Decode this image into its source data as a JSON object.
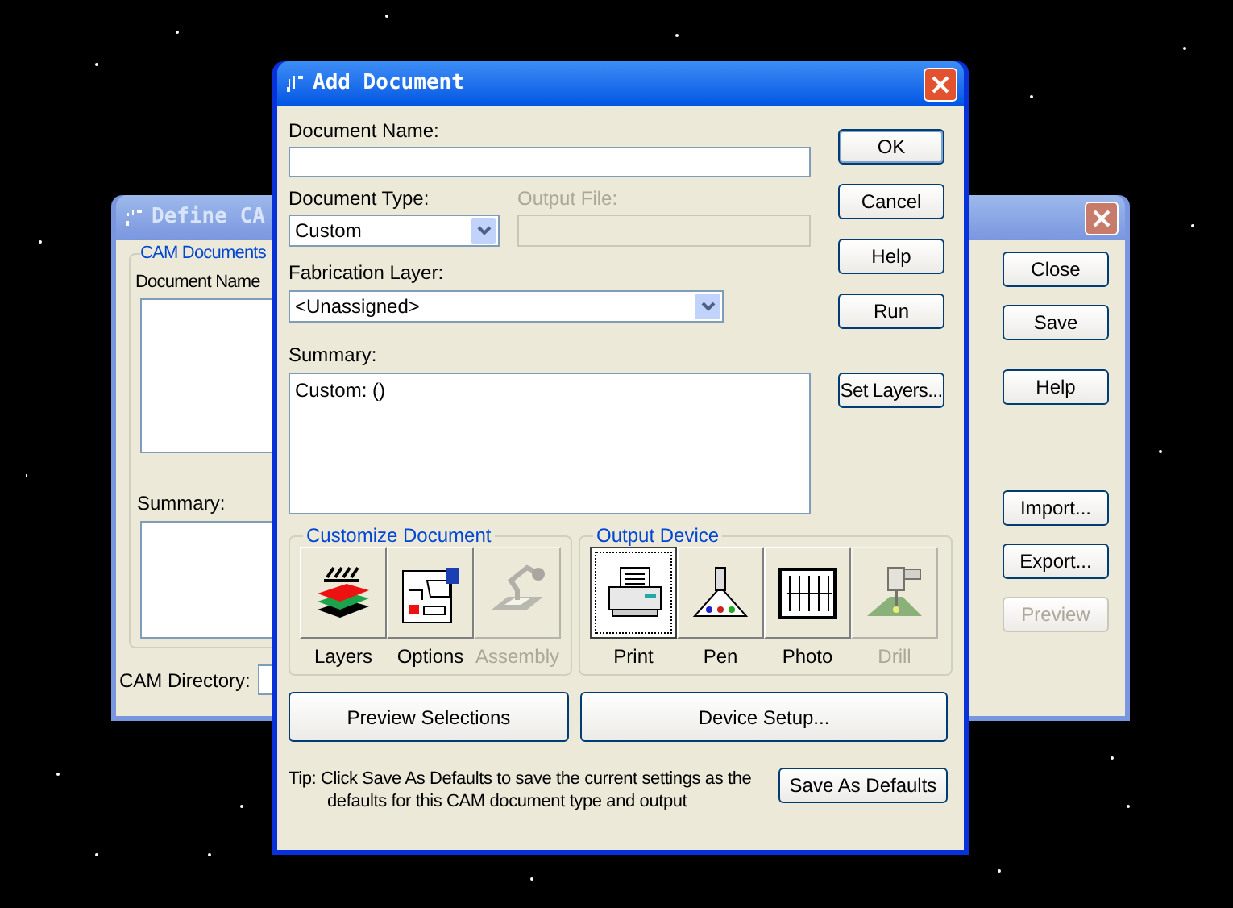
{
  "back_window": {
    "title": "Define CA",
    "group_label": "CAM Documents",
    "list_label": "Document Name",
    "summary_label": "Summary:",
    "directory_label": "CAM Directory:",
    "buttons": [
      {
        "label": "Close",
        "disabled": false
      },
      {
        "label": "Save",
        "disabled": false
      },
      {
        "label": "Help",
        "disabled": false
      },
      {
        "label": "Import...",
        "disabled": false
      },
      {
        "label": "Export...",
        "disabled": false
      },
      {
        "label": "Preview",
        "disabled": true
      }
    ]
  },
  "dialog": {
    "title": "Add Document",
    "name_label": "Document Name:",
    "type_label": "Document Type:",
    "type_value": "Custom",
    "output_label": "Output File:",
    "output_disabled": true,
    "layer_label": "Fabrication Layer:",
    "layer_value": "<Unassigned>",
    "summary_label": "Summary:",
    "summary_value": "Custom: ()",
    "buttons": [
      {
        "label": "OK",
        "default": true
      },
      {
        "label": "Cancel",
        "default": false
      },
      {
        "label": "Help",
        "default": false
      },
      {
        "label": "Run",
        "default": false
      },
      {
        "label": "Set Layers...",
        "default": false
      }
    ],
    "customize": {
      "label": "Customize Document",
      "items": [
        {
          "kind": "layers",
          "label": "Layers",
          "disabled": false
        },
        {
          "kind": "options",
          "label": "Options",
          "disabled": false
        },
        {
          "kind": "assembly",
          "label": "Assembly",
          "disabled": true
        }
      ]
    },
    "output_device": {
      "label": "Output Device",
      "items": [
        {
          "kind": "print",
          "label": "Print",
          "selected": true,
          "disabled": false
        },
        {
          "kind": "pen",
          "label": "Pen",
          "selected": false,
          "disabled": false
        },
        {
          "kind": "photo",
          "label": "Photo",
          "selected": false,
          "disabled": false
        },
        {
          "kind": "drill",
          "label": "Drill",
          "selected": false,
          "disabled": true
        }
      ]
    },
    "preview_button": "Preview Selections",
    "setup_button": "Device Setup...",
    "tip": "Tip: Click Save As Defaults to save the current settings as the defaults for this CAM document type and output",
    "defaults_button": "Save As Defaults"
  }
}
